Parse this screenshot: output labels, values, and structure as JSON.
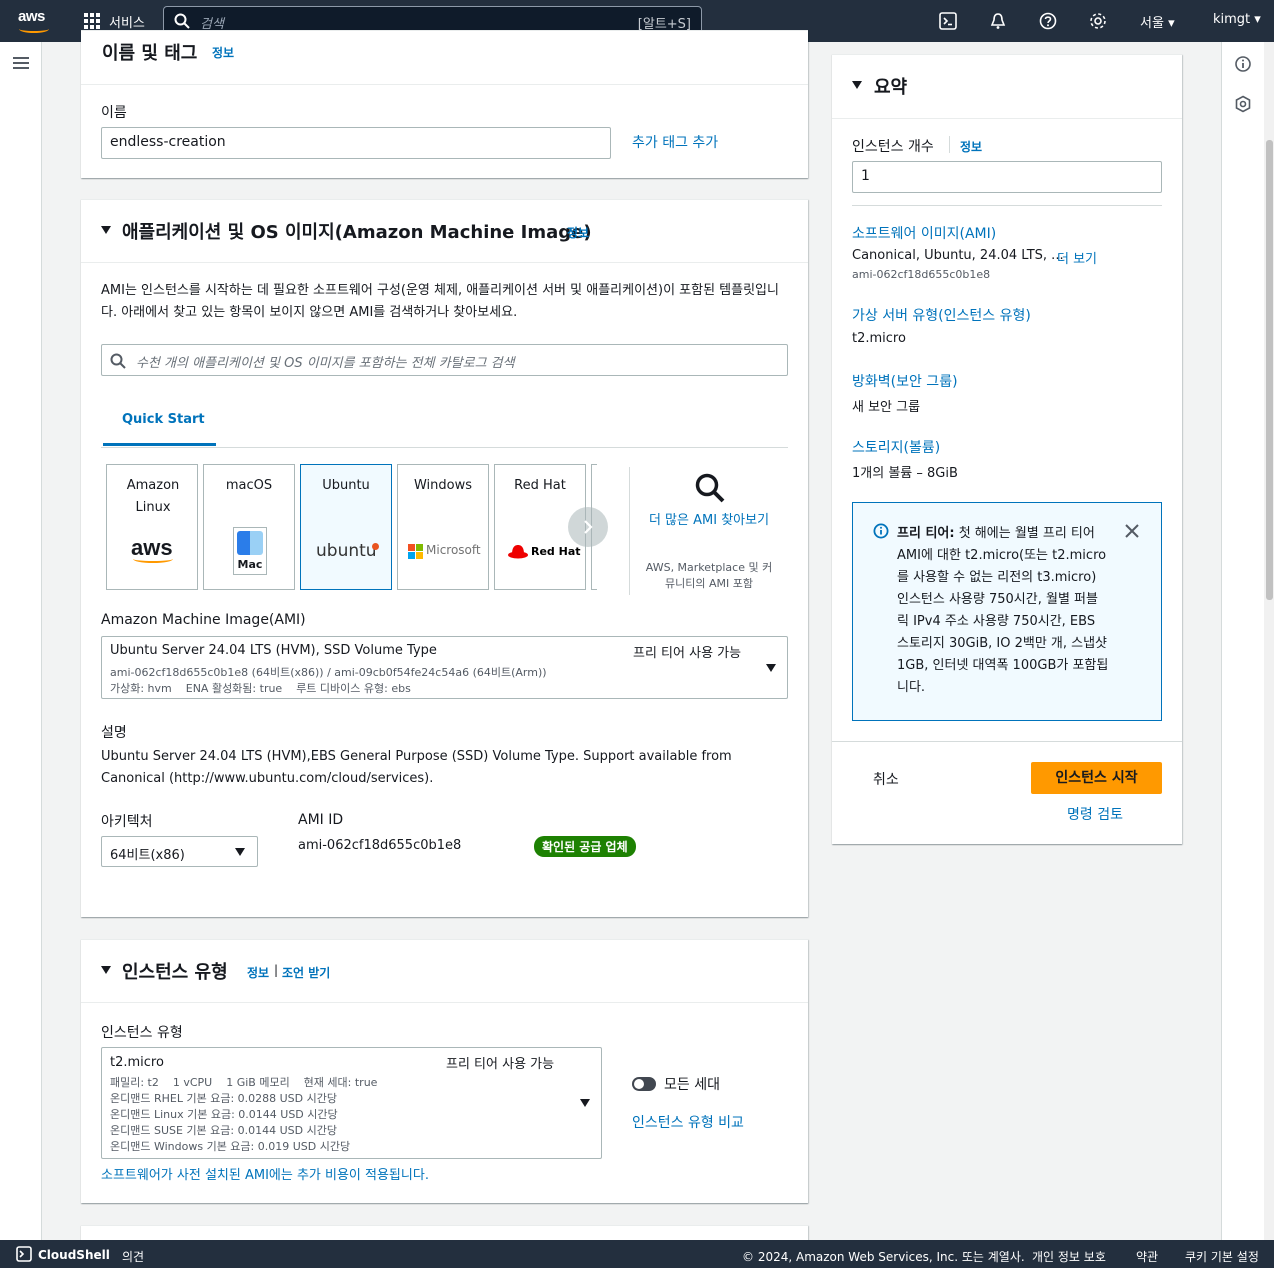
{
  "topnav": {
    "logo": "aws",
    "services_label": "서비스",
    "search_placeholder": "검색",
    "search_shortcut": "[알트+S]",
    "region": "서울",
    "user": "kimgt",
    "icons": [
      "cloudshell-icon",
      "bell-icon",
      "help-icon",
      "settings-icon"
    ]
  },
  "name_tags": {
    "title": "이름 및 태그",
    "info": "정보",
    "name_label": "이름",
    "name_value": "endless-creation",
    "add_tags": "추가 태그 추가"
  },
  "ami": {
    "title": "애플리케이션 및 OS 이미지(Amazon Machine Image)",
    "info": "정보",
    "description": "AMI는 인스턴스를 시작하는 데 필요한 소프트웨어 구성(운영 체제, 애플리케이션 서버 및 애플리케이션)이 포함된 템플릿입니다. 아래에서 찾고 있는 항목이 보이지 않으면 AMI를 검색하거나 찾아보세요.",
    "search_placeholder": "수천 개의 애플리케이션 및 OS 이미지를 포함하는 전체 카탈로그 검색",
    "tab": "Quick Start",
    "tiles": [
      {
        "name": "Amazon Linux",
        "logo": "aws"
      },
      {
        "name": "macOS",
        "logo": "Mac"
      },
      {
        "name": "Ubuntu",
        "logo": "ubuntu"
      },
      {
        "name": "Windows",
        "logo": "Microsoft"
      },
      {
        "name": "Red Hat",
        "logo": "Red Hat"
      }
    ],
    "browse_more": "더 많은 AMI 찾아보기",
    "browse_sub": "AWS, Marketplace 및 커뮤니티의 AMI 포함",
    "ami_label": "Amazon Machine Image(AMI)",
    "ami_name": "Ubuntu Server 24.04 LTS (HVM), SSD Volume Type",
    "ami_free": "프리 티어 사용 가능",
    "ami_ids": "ami-062cf18d655c0b1e8 (64비트(x86)) / ami-09cb0f54fe24c54a6 (64비트(Arm))",
    "ami_meta": "가상화: hvm    ENA 활성화됨: true    루트 디바이스 유형: ebs",
    "desc_label": "설명",
    "desc_text": "Ubuntu Server 24.04 LTS (HVM),EBS General Purpose (SSD) Volume Type. Support available from Canonical (http://www.ubuntu.com/cloud/services).",
    "arch_label": "아키텍처",
    "arch_value": "64비트(x86)",
    "amiid_label": "AMI ID",
    "amiid_value": "ami-062cf18d655c0b1e8",
    "verified": "확인된 공급 업체"
  },
  "instance_type": {
    "title": "인스턴스 유형",
    "info": "정보",
    "advice": "조언 받기",
    "label": "인스턴스 유형",
    "value": "t2.micro",
    "free": "프리 티어 사용 가능",
    "line1": "패밀리: t2    1 vCPU    1 GiB 메모리    현재 세대: true",
    "line2": "온디맨드 RHEL 기본 요금: 0.0288 USD 시간당",
    "line3": "온디맨드 Linux 기본 요금: 0.0144 USD 시간당",
    "line4": "온디맨드 SUSE 기본 요금: 0.0144 USD 시간당",
    "line5": "온디맨드 Windows 기본 요금: 0.019 USD 시간당",
    "all_gen": "모든 세대",
    "compare": "인스턴스 유형 비교",
    "note": "소프트웨어가 사전 설치된 AMI에는 추가 비용이 적용됩니다."
  },
  "summary": {
    "title": "요약",
    "count_label": "인스턴스 개수",
    "info": "정보",
    "count_value": "1",
    "sw_label": "소프트웨어 이미지(AMI)",
    "sw_value": "Canonical, Ubuntu, 24.04 LTS, ...",
    "more": "더 보기",
    "sw_id": "ami-062cf18d655c0b1e8",
    "vs_label": "가상 서버 유형(인스턴스 유형)",
    "vs_value": "t2.micro",
    "fw_label": "방화벽(보안 그룹)",
    "fw_value": "새 보안 그룹",
    "st_label": "스토리지(볼륨)",
    "st_value": "1개의 볼륨 – 8GiB",
    "free_title": "프리 티어:",
    "free_text": "첫 해에는 월별 프리 티어 AMI에 대한 t2.micro(또는 t2.micro를 사용할 수 없는 리전의 t3.micro) 인스턴스 사용량 750시간, 월별 퍼블릭 IPv4 주소 사용량 750시간, EBS 스토리지 30GiB, IO 2백만 개, 스냅샷 1GB, 인터넷 대역폭 100GB가 포함됩니다.",
    "cancel": "취소",
    "launch": "인스턴스 시작",
    "review": "명령 검토"
  },
  "footer": {
    "cloudshell": "CloudShell",
    "feedback": "의견",
    "copyright": "© 2024, Amazon Web Services, Inc. 또는 계열사.",
    "privacy": "개인 정보 보호",
    "terms": "약관",
    "cookies": "쿠키 기본 설정"
  },
  "colors": {
    "nav_bg": "#232f3e",
    "link": "#0073bb",
    "primary": "#ec7211",
    "badge": "#1d8102",
    "accent": "#ff9900"
  }
}
